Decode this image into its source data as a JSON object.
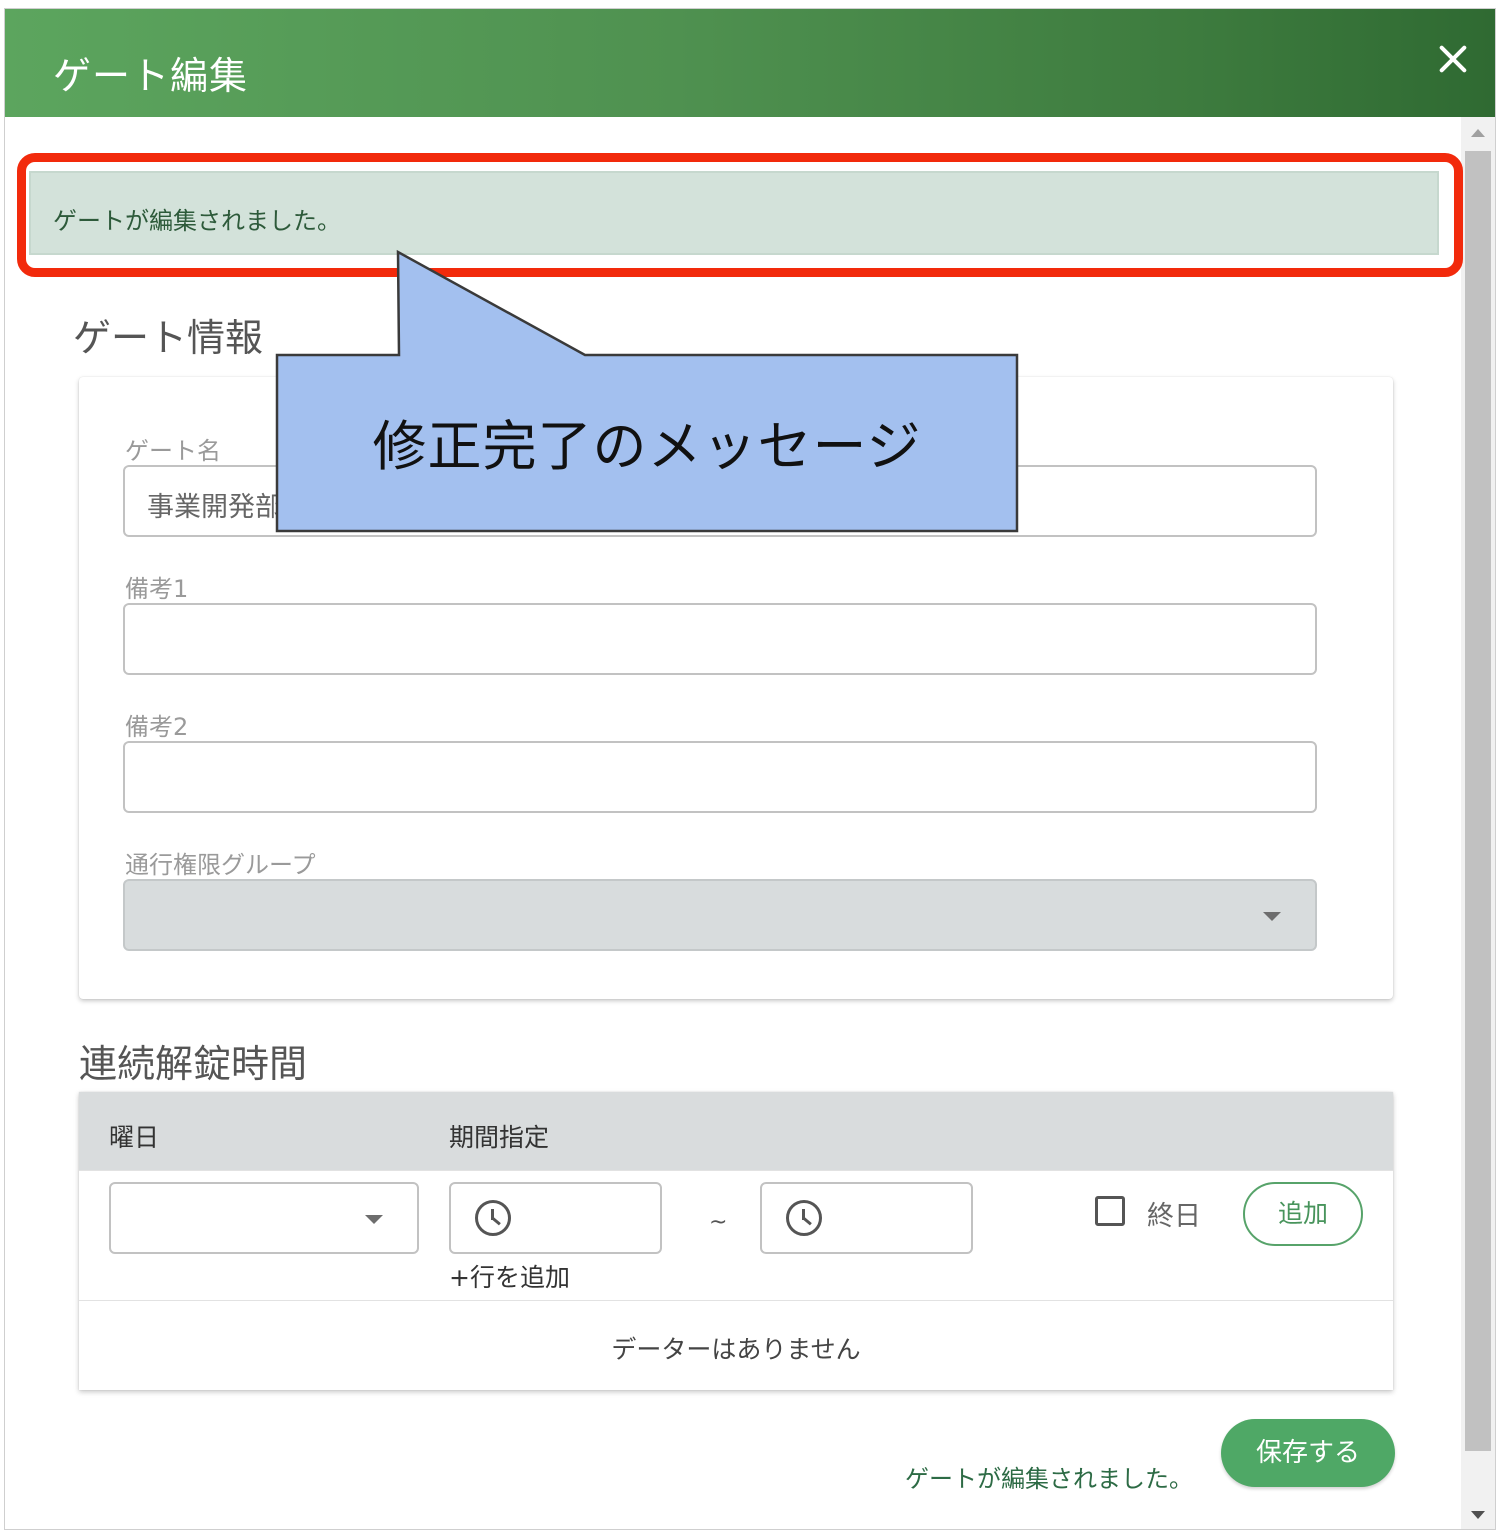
{
  "dialog": {
    "title": "ゲート編集",
    "close_icon": "close-icon",
    "header_gradient": [
      "#5ca55e",
      "#2f6a32"
    ]
  },
  "alert": {
    "message": "ゲートが編集されました。",
    "background": "#d3e2da",
    "highlight_color": "#f22a0c"
  },
  "annotation": {
    "text": "修正完了のメッセージ",
    "fill": "#a3c0ef"
  },
  "gate_info": {
    "section_title": "ゲート情報",
    "name_label": "ゲート名",
    "name_value": "事業開発部",
    "note1_label": "備考1",
    "note1_value": "",
    "note2_label": "備考2",
    "note2_value": "",
    "group_label": "通行権限グループ",
    "group_value": ""
  },
  "schedule": {
    "section_title": "連続解錠時間",
    "columns": [
      "曜日",
      "期間指定"
    ],
    "weekday_value": "",
    "start_time": "",
    "separator": "~",
    "end_time": "",
    "allday_label": "終日",
    "allday_checked": false,
    "add_label": "追加",
    "add_row_label": "+行を追加",
    "no_data": "データーはありません"
  },
  "footer": {
    "status_message": "ゲートが編集されました。",
    "save_label": "保存する",
    "save_color": "#4fa866"
  }
}
